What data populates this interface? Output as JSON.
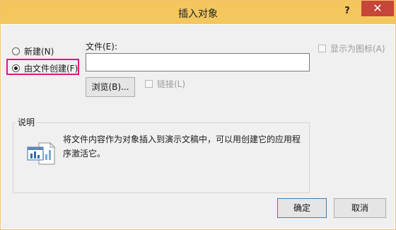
{
  "dialog": {
    "title": "插入对象",
    "help_label": "?",
    "close_label": "✕"
  },
  "options": {
    "new_label": "新建(N)",
    "from_file_label": "由文件创建(F)",
    "selected": "from_file"
  },
  "file": {
    "label": "文件(E):",
    "value": "",
    "browse_label": "浏览(B)...",
    "link_label": "链接(L)"
  },
  "display_as_icon_label": "显示为图标(A)",
  "description": {
    "title": "说明",
    "text": "将文件内容作为对象插入到演示文稿中，可以用创建它的应用程序激活它。",
    "icon": "file-object-icon"
  },
  "buttons": {
    "ok_label": "确定",
    "cancel_label": "取消"
  },
  "colors": {
    "titlebar": "#f3c75e",
    "close_button": "#c74539",
    "highlight_border": "#e0187f"
  }
}
